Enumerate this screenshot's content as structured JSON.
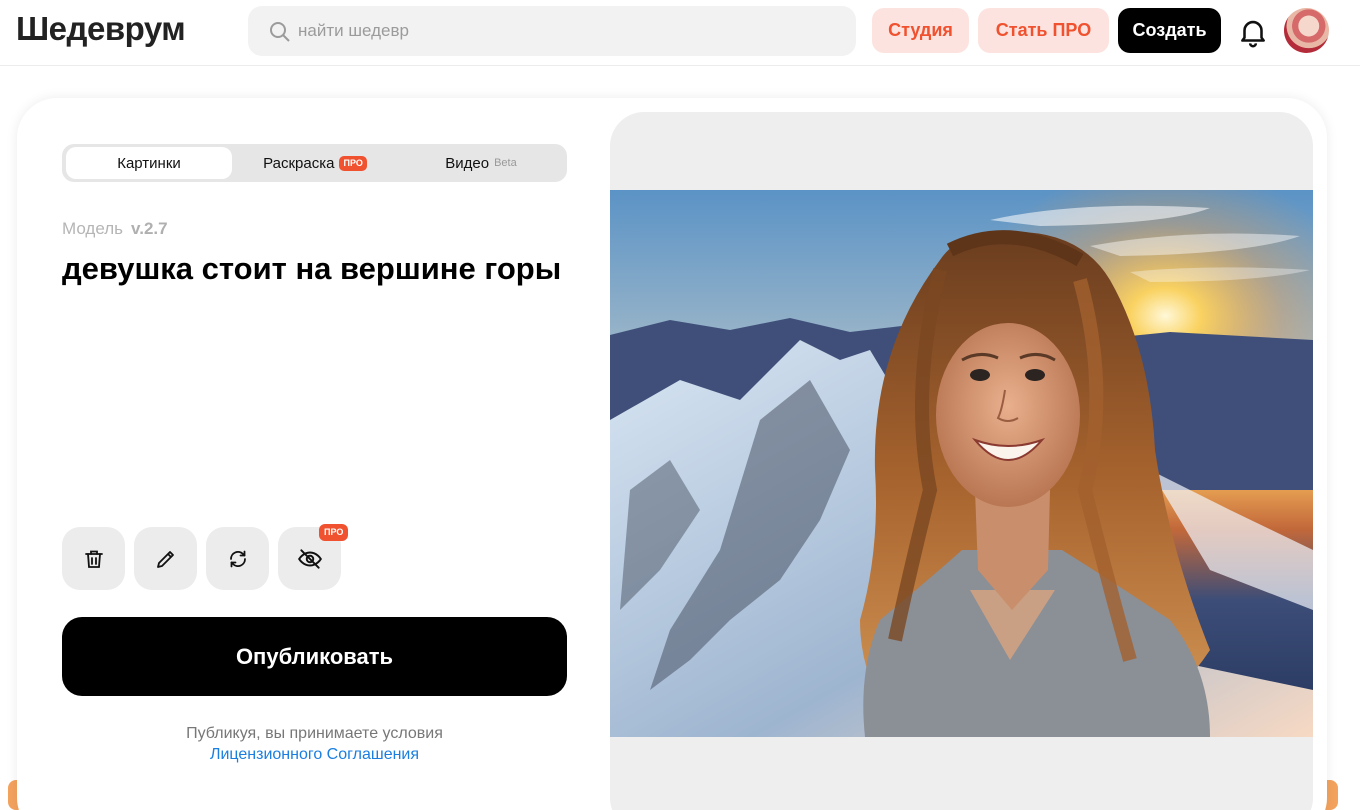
{
  "header": {
    "logo": "Шедеврум",
    "search_placeholder": "найти шедевр",
    "studio_label": "Студия",
    "pro_label": "Стать ПРО",
    "create_label": "Создать"
  },
  "tabs": [
    {
      "label": "Картинки",
      "active": true
    },
    {
      "label": "Раскраска",
      "badge": "ПРО"
    },
    {
      "label": "Видео",
      "badge": "Beta"
    }
  ],
  "model": {
    "label": "Модель",
    "version": "v.2.7"
  },
  "prompt": "девушка стоит на вершине горы",
  "tools": {
    "delete": "trash-icon",
    "edit": "pencil-icon",
    "regenerate": "refresh-icon",
    "hide": "eye-off-icon",
    "hide_badge": "ПРО"
  },
  "publish_label": "Опубликовать",
  "terms": {
    "text": "Публикуя, вы принимаете условия",
    "link": "Лицензионного Соглашения"
  },
  "colors": {
    "accent": "#f0512f",
    "accent_soft": "#fde3df",
    "link": "#1a7fe0"
  }
}
